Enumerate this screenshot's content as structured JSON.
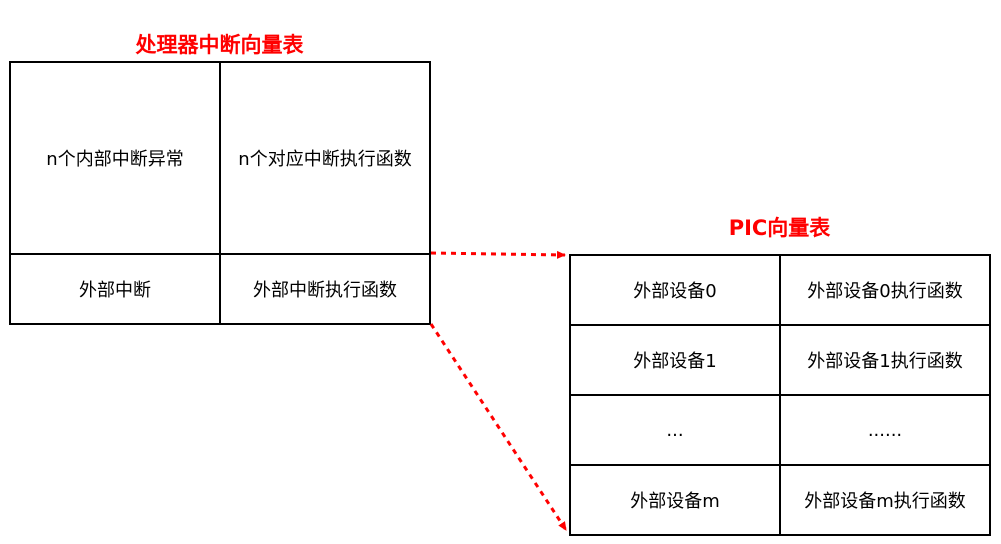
{
  "cpu_table": {
    "title": "处理器中断向量表",
    "rows": [
      {
        "left": "n个内部中断异常",
        "right": "n个对应中断执行函数"
      },
      {
        "left": "外部中断",
        "right": "外部中断执行函数"
      }
    ]
  },
  "pic_table": {
    "title": "PIC向量表",
    "rows": [
      {
        "left": "外部设备0",
        "right": "外部设备0执行函数"
      },
      {
        "left": "外部设备1",
        "right": "外部设备1执行函数"
      },
      {
        "left": "...",
        "right": "......"
      },
      {
        "left": "外部设备m",
        "right": "外部设备m执行函数"
      }
    ]
  },
  "colors": {
    "title": "#ff0000",
    "arrow": "#ff0000",
    "border": "#000000"
  }
}
